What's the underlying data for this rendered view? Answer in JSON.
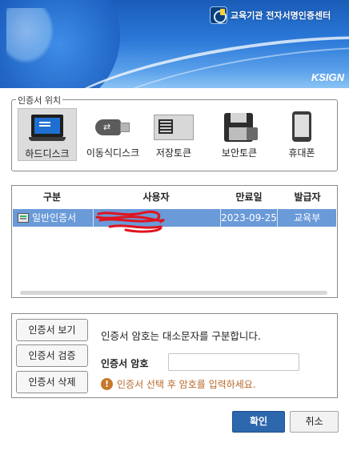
{
  "header": {
    "title": "교육기관 전자서명인증센터",
    "brand": "KSIGN"
  },
  "location": {
    "legend": "인증서 위치",
    "items": [
      {
        "label": "하드디스크",
        "icon": "laptop-icon",
        "selected": true
      },
      {
        "label": "이동식디스크",
        "icon": "usb-drive-icon",
        "selected": false
      },
      {
        "label": "저장토큰",
        "icon": "sim-card-icon",
        "selected": false
      },
      {
        "label": "보안토큰",
        "icon": "security-token-icon",
        "selected": false
      },
      {
        "label": "휴대폰",
        "icon": "mobile-phone-icon",
        "selected": false
      }
    ]
  },
  "certificates": {
    "columns": [
      "구분",
      "사용자",
      "만료일",
      "발급자"
    ],
    "rows": [
      {
        "type": "일반인증서",
        "user": "",
        "expiry": "2023-09-25",
        "issuer": "교육부",
        "selected": true
      }
    ]
  },
  "actions": {
    "view_label": "인증서 보기",
    "verify_label": "인증서 검증",
    "delete_label": "인증서 삭제",
    "info_text": "인증서 암호는 대소문자를 구분합니다.",
    "password_label": "인증서 암호",
    "password_value": "",
    "warning_text": "인증서 선택 후 암호를 입력하세요.",
    "warning_icon": "!"
  },
  "footer": {
    "ok_label": "확인",
    "cancel_label": "취소"
  },
  "colors": {
    "selected_row": "#6a9ad8",
    "ok_button": "#2d67ad",
    "warning": "#b8682a"
  }
}
